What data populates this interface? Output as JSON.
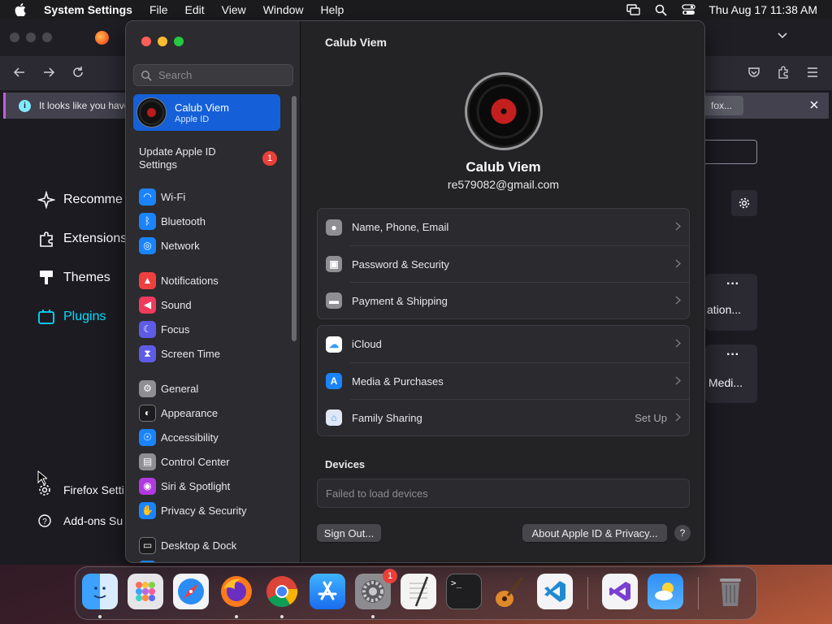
{
  "menubar": {
    "app_name": "System Settings",
    "items": [
      "File",
      "Edit",
      "View",
      "Window",
      "Help"
    ],
    "clock": "Thu Aug 17  11:38 AM"
  },
  "firefox": {
    "notice_text": "It looks like you have",
    "notice_button": "fox...",
    "nav": [
      {
        "label": "Recomme",
        "icon": "sparkle-icon"
      },
      {
        "label": "Extensions",
        "icon": "puzzle-icon"
      },
      {
        "label": "Themes",
        "icon": "brush-icon"
      },
      {
        "label": "Plugins",
        "icon": "plugin-icon"
      }
    ],
    "footer": [
      {
        "label": "Firefox Setti",
        "icon": "gear-icon"
      },
      {
        "label": "Add-ons Su",
        "icon": "help-icon"
      }
    ],
    "card1_text": "ation...",
    "card2_text": "Medi...",
    "card_menu": "···"
  },
  "settings": {
    "search_placeholder": "Search",
    "user": {
      "name": "Calub Viem",
      "subtitle": "Apple ID"
    },
    "update": {
      "label": "Update Apple ID Settings",
      "badge": "1"
    },
    "sidebar_items": [
      {
        "label": "Wi-Fi",
        "icon": "wifi-icon",
        "color": "#1a84ff"
      },
      {
        "label": "Bluetooth",
        "icon": "bluetooth-icon",
        "color": "#1a84ff"
      },
      {
        "label": "Network",
        "icon": "globe-icon",
        "color": "#1a84ff"
      },
      {
        "label": "Notifications",
        "icon": "bell-icon",
        "color": "#ef4040"
      },
      {
        "label": "Sound",
        "icon": "speaker-icon",
        "color": "#ef3a5d"
      },
      {
        "label": "Focus",
        "icon": "moon-icon",
        "color": "#5e5ce6"
      },
      {
        "label": "Screen Time",
        "icon": "hourglass-icon",
        "color": "#5e5ce6"
      },
      {
        "label": "General",
        "icon": "gear-icon",
        "color": "#8e8e93"
      },
      {
        "label": "Appearance",
        "icon": "appearance-icon",
        "color": "#1c1c1e"
      },
      {
        "label": "Accessibility",
        "icon": "accessibility-icon",
        "color": "#1a84ff"
      },
      {
        "label": "Control Center",
        "icon": "control-center-icon",
        "color": "#8e8e93"
      },
      {
        "label": "Siri & Spotlight",
        "icon": "siri-icon",
        "color": "#b03adf"
      },
      {
        "label": "Privacy & Security",
        "icon": "hand-icon",
        "color": "#1a84ff"
      },
      {
        "label": "Desktop & Dock",
        "icon": "dock-icon",
        "color": "#1c1c1e"
      }
    ],
    "main": {
      "title": "Calub Viem",
      "name": "Calub Viem",
      "email": "re579082@gmail.com",
      "group1": [
        {
          "label": "Name, Phone, Email",
          "icon": "contact-icon"
        },
        {
          "label": "Password & Security",
          "icon": "lock-icon"
        },
        {
          "label": "Payment & Shipping",
          "icon": "card-icon"
        }
      ],
      "group2": [
        {
          "label": "iCloud",
          "icon": "icloud-icon",
          "extra": ""
        },
        {
          "label": "Media & Purchases",
          "icon": "appstore-icon",
          "extra": ""
        },
        {
          "label": "Family Sharing",
          "icon": "family-icon",
          "extra": "Set Up"
        }
      ],
      "devices_label": "Devices",
      "devices_status": "Failed to load devices",
      "sign_out": "Sign Out...",
      "about": "About Apple ID & Privacy...",
      "help": "?"
    }
  },
  "dock": {
    "apps": [
      "Finder",
      "Launchpad",
      "Safari",
      "Firefox",
      "Chrome",
      "App Store",
      "System Settings",
      "TextEdit",
      "Terminal",
      "GarageBand",
      "VS Code",
      "Visual Studio",
      "Weather",
      "Trash"
    ],
    "settings_badge": "1",
    "terminal_prompt": ">_"
  }
}
